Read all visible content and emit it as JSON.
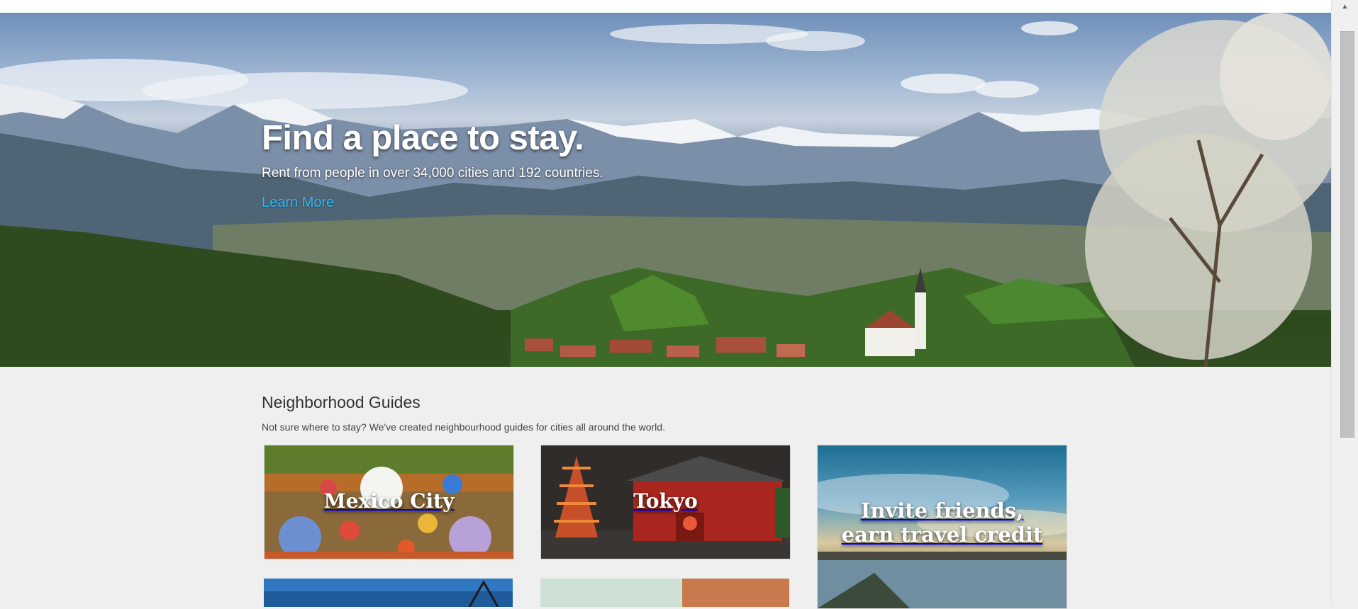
{
  "hero": {
    "title": "Find a place to stay.",
    "subtitle": "Rent from people in over 34,000 cities and 192 countries.",
    "link_label": "Learn More"
  },
  "guides": {
    "heading": "Neighborhood Guides",
    "description": "Not sure where to stay? We've created neighbourhood guides for cities all around the world.",
    "cards": [
      {
        "label": "Mexico City"
      },
      {
        "label": "Tokyo"
      },
      {
        "label_line1": "Invite friends,",
        "label_line2": "earn travel credit"
      }
    ]
  },
  "colors": {
    "link": "#2fb8f4",
    "page_background": "#efefef"
  },
  "icons": {
    "scroll_up": "triangle-up"
  }
}
